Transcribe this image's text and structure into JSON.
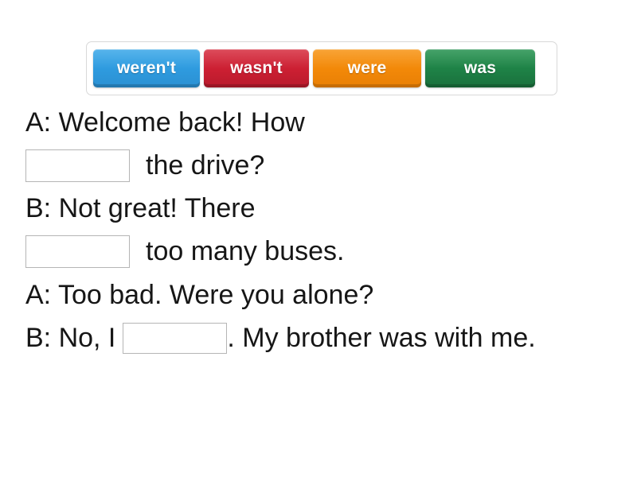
{
  "word_bank": {
    "tiles": [
      {
        "label": "weren't",
        "color": "#2f9ee0"
      },
      {
        "label": "wasn't",
        "color": "#ce1f33"
      },
      {
        "label": "were",
        "color": "#f38b0a"
      },
      {
        "label": "was",
        "color": "#1e7f44"
      }
    ]
  },
  "exercise": {
    "lines": [
      {
        "id": "line-1",
        "before": "A: Welcome back! How",
        "blank": false,
        "after": ""
      },
      {
        "id": "line-2",
        "before": "",
        "blank": true,
        "after": "the drive?"
      },
      {
        "id": "line-3",
        "before": "B: Not great! There",
        "blank": false,
        "after": ""
      },
      {
        "id": "line-4",
        "before": "",
        "blank": true,
        "after": "too many buses."
      },
      {
        "id": "line-5",
        "before": "A: Too bad. Were you alone?",
        "blank": false,
        "after": ""
      },
      {
        "id": "line-6",
        "before": "B: No, I",
        "blank": true,
        "after": ". My brother was with me."
      }
    ],
    "blank_value": ""
  }
}
